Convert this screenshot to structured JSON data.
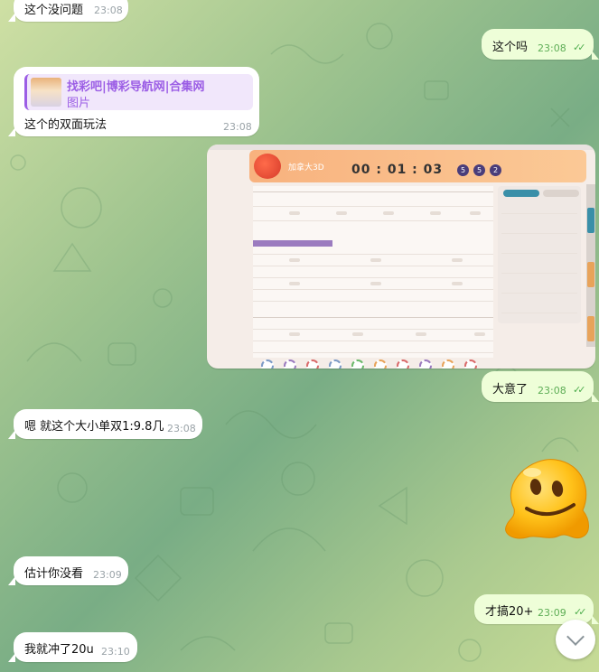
{
  "messages": {
    "m1": {
      "text": "这个没问题",
      "time": "23:08"
    },
    "m2": {
      "text": "这个吗",
      "time": "23:08"
    },
    "m3": {
      "reply_title": "找彩吧|博彩导航网|合集网",
      "reply_sub": "图片",
      "text": "这个的双面玩法",
      "time": "23:08"
    },
    "m4": {
      "text": "大意了",
      "time": "23:08"
    },
    "m5": {
      "text": "嗯 就这个大小单双1:9.8几",
      "time": "23:08"
    },
    "m6": {
      "text": "估计你没看",
      "time": "23:09"
    },
    "m7": {
      "text": "才搞20+",
      "time": "23:09"
    },
    "m8": {
      "text": "我就冲了20u",
      "time": "23:10"
    }
  },
  "screenshot": {
    "logo_text": "加拿大3D",
    "timer": "00 : 01 : 03",
    "balls": [
      "5",
      "5",
      "2"
    ]
  },
  "colors": {
    "incoming_bubble": "#ffffff",
    "outgoing_bubble": "#eefed8",
    "accent_purple": "#9b5de5",
    "check_green": "#4fae4e"
  },
  "icons": {
    "read_receipt": "double-check-icon",
    "scroll": "chevron-down-icon"
  }
}
